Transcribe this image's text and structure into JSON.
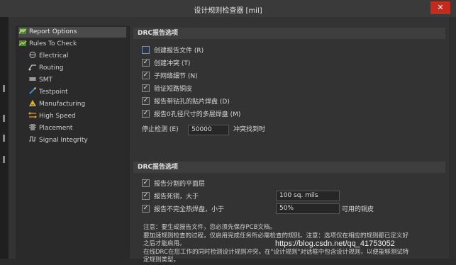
{
  "window": {
    "title": "设计规则检查器 [mil]",
    "close_glyph": "✕"
  },
  "tree": [
    {
      "label": "Report Options",
      "icon": "report-options-icon",
      "selected": true
    },
    {
      "label": "Rules To Check",
      "icon": "rules-icon",
      "selected": false
    },
    {
      "label": "Electrical",
      "icon": "electrical-icon",
      "selected": false
    },
    {
      "label": "Routing",
      "icon": "routing-icon",
      "selected": false
    },
    {
      "label": "SMT",
      "icon": "smt-icon",
      "selected": false
    },
    {
      "label": "Testpoint",
      "icon": "testpoint-icon",
      "selected": false
    },
    {
      "label": "Manufacturing",
      "icon": "manufacturing-icon",
      "selected": false
    },
    {
      "label": "High Speed",
      "icon": "high-speed-icon",
      "selected": false
    },
    {
      "label": "Placement",
      "icon": "placement-icon",
      "selected": false
    },
    {
      "label": "Signal Integrity",
      "icon": "signal-integrity-icon",
      "selected": false
    }
  ],
  "section1": {
    "title": "DRC报告选项",
    "options": [
      {
        "label": "创建报告文件",
        "shortcut": "(R)",
        "checked": false
      },
      {
        "label": "创建冲突",
        "shortcut": "(T)",
        "checked": true
      },
      {
        "label": "子网络细节",
        "shortcut": "(N)",
        "checked": true
      },
      {
        "label": "验证短路铜皮",
        "shortcut": "",
        "checked": true
      },
      {
        "label": "报告带钻孔的贴片焊盘",
        "shortcut": "(D)",
        "checked": true
      },
      {
        "label": "报告0孔径尺寸的多层焊盘",
        "shortcut": "(M)",
        "checked": true
      }
    ],
    "stop_label": "停止检测",
    "stop_shortcut": "(E)",
    "stop_value": "50000",
    "stop_suffix": "冲突找到时"
  },
  "section2": {
    "title": "DRC报告选项",
    "options": [
      {
        "label": "报告分割的平面层",
        "checked": true
      },
      {
        "label": "报告死铜，大于",
        "checked": true,
        "value": "100 sq. mils",
        "suffix": ""
      },
      {
        "label": "报告不完全热焊盘，小于",
        "checked": true,
        "value": "50%",
        "suffix": "可用的铜皮"
      }
    ]
  },
  "note": {
    "lines": [
      "注意：要生成报告文件，您必须先保存PCB文档。",
      "要加速规则检查的过程，仅启用完成任务所必需检查的规则。注意：选项仅在相应的规则都已定义好",
      "之后才能启用。",
      "在线DRC在您工作的同时检测设计规则冲突。在\"设计规则\"对话框中包含设计规则，以便能够测试特",
      "定规则类型。"
    ]
  },
  "watermark": "https://blog.csdn.net/qq_41753052",
  "colors": {
    "accent_close": "#c42b1c",
    "background": "#333333",
    "header": "#3e3e3e"
  }
}
